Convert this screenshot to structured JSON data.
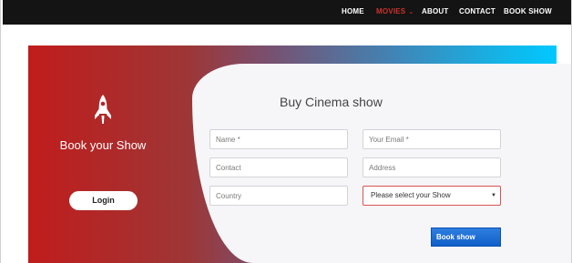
{
  "nav": {
    "items": [
      {
        "label": "HOME"
      },
      {
        "label": "MOVIES"
      },
      {
        "label": "ABOUT"
      },
      {
        "label": "CONTACT"
      },
      {
        "label": "BOOK SHOW"
      }
    ],
    "active": "MOVIES"
  },
  "hero": {
    "icon": "rocket-icon",
    "title": "Book your Show",
    "login_label": "Login"
  },
  "form": {
    "title": "Buy Cinema show",
    "name_placeholder": "Name *",
    "email_placeholder": "Your Email *",
    "contact_placeholder": "Contact",
    "address_placeholder": "Address",
    "country_placeholder": "Country",
    "show_select": "Please select your Show",
    "submit_label": "Book show"
  },
  "colors": {
    "nav_bg": "#141414",
    "active_nav": "#c9332b",
    "gradient_start": "#c11c1c",
    "gradient_end": "#00c8ff",
    "panel_bg": "#f6f6f9",
    "submit_bg": "#1e6fd9",
    "select_border": "#d9534f"
  }
}
